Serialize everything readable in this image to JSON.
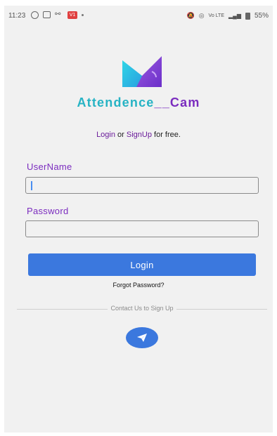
{
  "status_bar": {
    "time": "11:23",
    "notification_badge": "V1",
    "right_text": "Vo LTE",
    "battery": "55%"
  },
  "app": {
    "title_part1": "Attendence",
    "title_separator": "__",
    "title_part2": "Cam",
    "title_colors": {
      "part1": "#26b3c4",
      "part2": "#7b2cbf"
    }
  },
  "tagline": {
    "login_link": "Login",
    "or_text": "or",
    "signup_link": "SignUp",
    "suffix": "for free."
  },
  "form": {
    "username_label": "UserName",
    "username_value": "",
    "password_label": "Password",
    "password_value": "",
    "login_button": "Login",
    "forgot_password": "Forgot Password?"
  },
  "footer": {
    "contact_text": "Contact Us to Sign Up",
    "fab_icon": "telegram-send-icon"
  },
  "colors": {
    "accent": "#3b78de",
    "label": "#7b2cbf",
    "background": "#f1f1f1"
  }
}
